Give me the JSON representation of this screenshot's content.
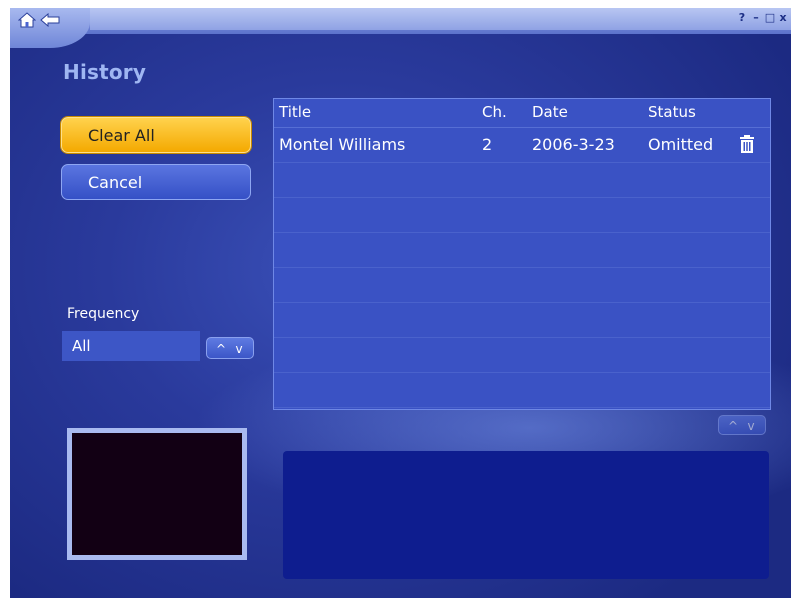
{
  "header": {
    "icons": [
      "home-icon",
      "back-icon",
      "help-icon",
      "minimize-icon",
      "maximize-icon",
      "close-icon"
    ],
    "help_glyph": "?",
    "min_glyph": "–",
    "max_glyph": "□",
    "close_glyph": "x"
  },
  "page": {
    "title": "History"
  },
  "actions": {
    "clear_all": "Clear All",
    "cancel": "Cancel"
  },
  "frequency": {
    "label": "Frequency",
    "value": "All",
    "up": "^",
    "down": "v"
  },
  "list": {
    "columns": {
      "title": "Title",
      "ch": "Ch.",
      "date": "Date",
      "status": "Status"
    },
    "rows": [
      {
        "title": "Montel Williams",
        "ch": "2",
        "date": "2006-3-23",
        "status": "Omitted",
        "icon": "trash-icon"
      }
    ],
    "scroll_up": "^",
    "scroll_down": "v"
  },
  "colors": {
    "accent": "#f4a900",
    "background": "#2a3a9c",
    "title": "#9fb6f2",
    "list": "#3a52c4",
    "info": "#0e1d8f"
  }
}
